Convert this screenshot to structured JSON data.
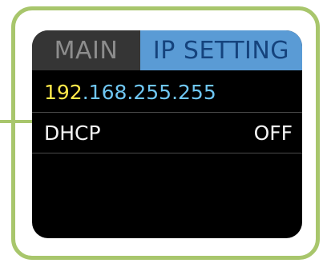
{
  "tabs": {
    "main": "MAIN",
    "ip_setting": "IP SETTING"
  },
  "ip": {
    "segments": [
      "192",
      "168",
      "255",
      "255"
    ],
    "separator": ".",
    "editing_segment_index": 0
  },
  "dhcp": {
    "label": "DHCP",
    "value": "OFF"
  },
  "colors": {
    "frame": "#a8c66c",
    "active_tab": "#5a9bd5",
    "inactive_tab": "#353535",
    "ip_editing": "#ffe84a",
    "ip_text": "#6fc6f2"
  }
}
